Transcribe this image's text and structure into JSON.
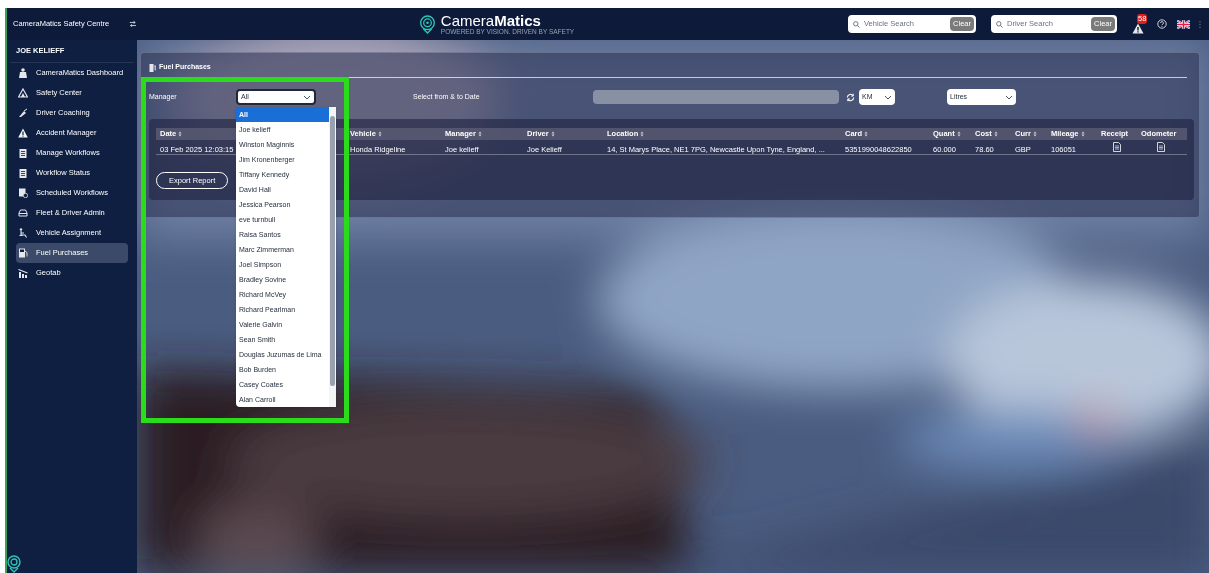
{
  "header": {
    "app_title": "CameraMatics Safety Centre",
    "logo_text": "Camera**Matics**",
    "logo_tagline": "POWERED BY VISION. DRIVEN BY SAFETY",
    "vehicle_search": {
      "placeholder": "Vehicle Search",
      "button": "Clear"
    },
    "driver_search": {
      "placeholder": "Driver Search",
      "button": "Clear"
    },
    "alert_count": "58"
  },
  "sidebar": {
    "user": "JOE KELIEFF",
    "items": [
      {
        "label": "CameraMatics Dashboard",
        "selected": false
      },
      {
        "label": "Safety Center",
        "selected": false
      },
      {
        "label": "Driver Coaching",
        "selected": false
      },
      {
        "label": "Accident Manager",
        "selected": false
      },
      {
        "label": "Manage Workflows",
        "selected": false
      },
      {
        "label": "Workflow Status",
        "selected": false
      },
      {
        "label": "Scheduled Workflows",
        "selected": false
      },
      {
        "label": "Fleet & Driver Admin",
        "selected": false
      },
      {
        "label": "Vehicle Assignment",
        "selected": false
      },
      {
        "label": "Fuel Purchases",
        "selected": true
      },
      {
        "label": "Geotab",
        "selected": false
      }
    ]
  },
  "panel": {
    "title": "Fuel Purchases",
    "filters": {
      "manager_label": "Manager",
      "manager_value": "All",
      "expanded": true,
      "date_label": "Select from & to Date",
      "unit": "KM",
      "volume": "Litres"
    },
    "manager_options": [
      {
        "label": "All",
        "selected": true
      },
      {
        "label": "Joe kelieff",
        "selected": false
      },
      {
        "label": "Winston Maginnis",
        "selected": false
      },
      {
        "label": "Jim Kronenberger",
        "selected": false
      },
      {
        "label": "Tiffany Kennedy",
        "selected": false
      },
      {
        "label": "David Hall",
        "selected": false
      },
      {
        "label": "Jessica Pearson",
        "selected": false
      },
      {
        "label": "eve turnbull",
        "selected": false
      },
      {
        "label": "Raisa Santos",
        "selected": false
      },
      {
        "label": "Marc Zimmerman",
        "selected": false
      },
      {
        "label": "Joel Simpson",
        "selected": false
      },
      {
        "label": "Bradley Sovine",
        "selected": false
      },
      {
        "label": "Richard McVey",
        "selected": false
      },
      {
        "label": "Richard Pearlman",
        "selected": false
      },
      {
        "label": "Valerie Galvin",
        "selected": false
      },
      {
        "label": "Sean Smith",
        "selected": false
      },
      {
        "label": "Douglas Juzumas de Lima",
        "selected": false
      },
      {
        "label": "Bob Burden",
        "selected": false
      },
      {
        "label": "Casey Coates",
        "selected": false
      },
      {
        "label": "Alan Carroll",
        "selected": false
      }
    ],
    "table": {
      "columns": [
        {
          "label": "Date",
          "sortable": true
        },
        {
          "label": "Vehicle",
          "sortable": true
        },
        {
          "label": "Manager",
          "sortable": true
        },
        {
          "label": "Driver",
          "sortable": true
        },
        {
          "label": "Location",
          "sortable": true
        },
        {
          "label": "Card",
          "sortable": true
        },
        {
          "label": "Quant",
          "sortable": true
        },
        {
          "label": "Cost",
          "sortable": true
        },
        {
          "label": "Curr",
          "sortable": true
        },
        {
          "label": "Mileage",
          "sortable": true
        },
        {
          "label": "Receipt",
          "sortable": false
        },
        {
          "label": "Odometer",
          "sortable": false
        }
      ],
      "rows": [
        {
          "cells": [
            "03 Feb 2025 12:03:15",
            "Honda Ridgeline",
            "Joe kelieff",
            "Joe Kelieff",
            "14, St Marys Place, NE1 7PG, Newcastle Upon Tyne, England, ...",
            "5351990048622850",
            "60.000",
            "78.60",
            "GBP",
            "106051"
          ],
          "receipt": true,
          "odometer": true
        }
      ]
    },
    "export_button": "Export Report"
  }
}
